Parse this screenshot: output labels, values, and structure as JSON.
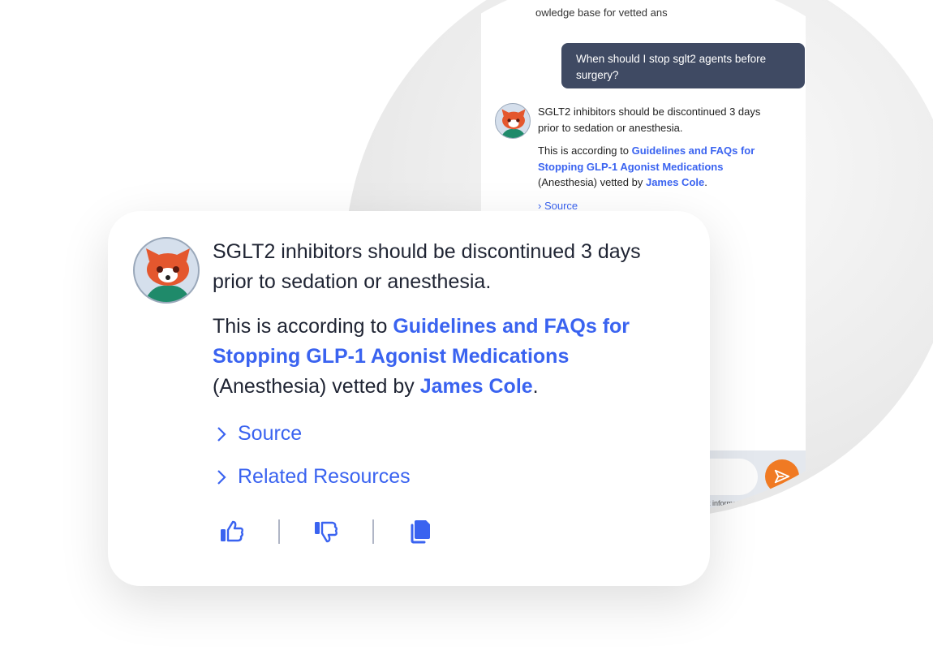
{
  "back_chat": {
    "intro_fragment": "owledge base for vetted ans",
    "user_message": "When should I stop sglt2 agents before surgery?",
    "answer": {
      "text1": "SGLT2 inhibitors should be discontinued 3 days prior to sedation or anesthesia.",
      "pre": "This is according to ",
      "link": "Guidelines and FAQs for Stopping GLP-1 Agonist Medications",
      "mid": " (Anesthesia) vetted by ",
      "author": "James Cole",
      "end": ".",
      "source": "Source"
    },
    "input_hint": "nt information",
    "send_icon": "paper-plane-icon"
  },
  "card": {
    "text1": "SGLT2 inhibitors should be discontinued 3 days prior to sedation or anesthesia.",
    "pre": "This is according to ",
    "link": "Guidelines and FAQs for Stopping GLP-1 Agonist Medications",
    "mid": " (Anesthesia) vetted by ",
    "author": "James Cole",
    "end": ".",
    "source": "Source",
    "related": "Related Resources",
    "actions": [
      "thumbs-up-icon",
      "thumbs-down-icon",
      "copy-icon"
    ]
  },
  "colors": {
    "accent": "#3a63f0",
    "user_bubble": "#3f4a63",
    "send": "#f07a23"
  }
}
